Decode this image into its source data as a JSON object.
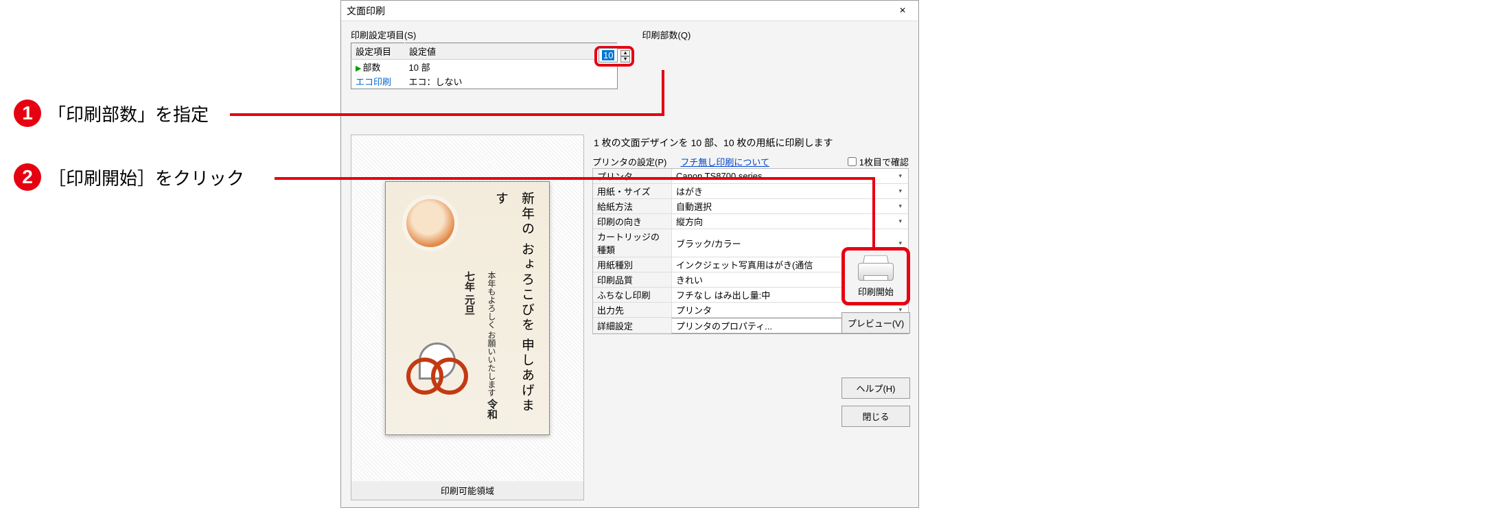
{
  "callouts": {
    "c1_num": "1",
    "c1_text": "「印刷部数」を指定",
    "c2_num": "2",
    "c2_text": "［印刷開始］をクリック"
  },
  "dialog": {
    "title": "文面印刷",
    "close": "×"
  },
  "settings": {
    "section_label": "印刷設定項目(S)",
    "headers": {
      "col1": "設定項目",
      "col2": "設定値"
    },
    "rows": [
      {
        "name": "部数",
        "value": "10 部",
        "active": true
      },
      {
        "name": "エコ印刷",
        "value": "エコ：しない",
        "blue": true
      }
    ]
  },
  "copies": {
    "label": "印刷部数(Q)",
    "value": "10"
  },
  "preview": {
    "greeting_main": "新年の おょろこびを 申しあげます",
    "greeting_sub1": "本年もよろしく",
    "greeting_sub2": "お願いいたします",
    "date": "令和七年 元旦",
    "footer": "印刷可能領域"
  },
  "summary": "1 枚の文面デザインを 10 部、10 枚の用紙に印刷します",
  "printer_header": {
    "label": "プリンタの設定(P)",
    "link": "フチ無し印刷について",
    "confirm": "1枚目で確認"
  },
  "config": [
    {
      "k": "プリンタ",
      "v": "Canon TS8700 series"
    },
    {
      "k": "用紙・サイズ",
      "v": "はがき"
    },
    {
      "k": "給紙方法",
      "v": "自動選択"
    },
    {
      "k": "印刷の向き",
      "v": "縦方向"
    },
    {
      "k": "カートリッジの種類",
      "v": "ブラック/カラー"
    },
    {
      "k": "用紙種別",
      "v": "インクジェット写真用はがき(通信"
    },
    {
      "k": "印刷品質",
      "v": "きれい"
    },
    {
      "k": "ふちなし印刷",
      "v": "フチなし はみ出し量:中"
    },
    {
      "k": "出力先",
      "v": "プリンタ"
    }
  ],
  "detail_row": {
    "k": "詳細設定",
    "btn": "プリンタのプロパティ..."
  },
  "actions": {
    "print_start": "印刷開始",
    "preview": "プレビュー(V)",
    "help": "ヘルプ(H)",
    "close": "閉じる"
  }
}
